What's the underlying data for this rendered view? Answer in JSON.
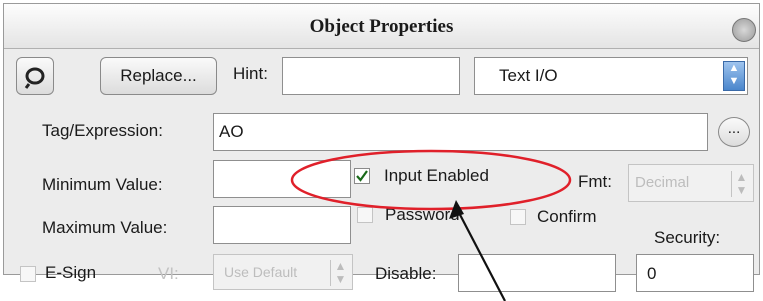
{
  "window": {
    "title": "Object Properties"
  },
  "toolbar": {
    "replace_label": "Replace...",
    "hint_label": "Hint:",
    "hint_value": "",
    "type_value": "Text I/O"
  },
  "tag": {
    "label": "Tag/Expression:",
    "value": "AO",
    "browse_label": "..."
  },
  "min": {
    "label": "Minimum Value:",
    "value": ""
  },
  "max": {
    "label": "Maximum Value:",
    "value": ""
  },
  "input_enabled": {
    "label": "Input Enabled",
    "checked": true
  },
  "password": {
    "label": "Password",
    "checked": false
  },
  "confirm": {
    "label": "Confirm",
    "checked": false
  },
  "fmt": {
    "label": "Fmt:",
    "value": "Decimal"
  },
  "security": {
    "label": "Security:",
    "value": "0"
  },
  "esign": {
    "label": "E-Sign",
    "vi_label": "VI:",
    "vi_value": "Use Default"
  },
  "disable": {
    "label": "Disable:",
    "value": ""
  },
  "colors": {
    "highlight": "#e0202a",
    "title_bg": "#f2f2f2",
    "panel_bg": "#ececec"
  }
}
